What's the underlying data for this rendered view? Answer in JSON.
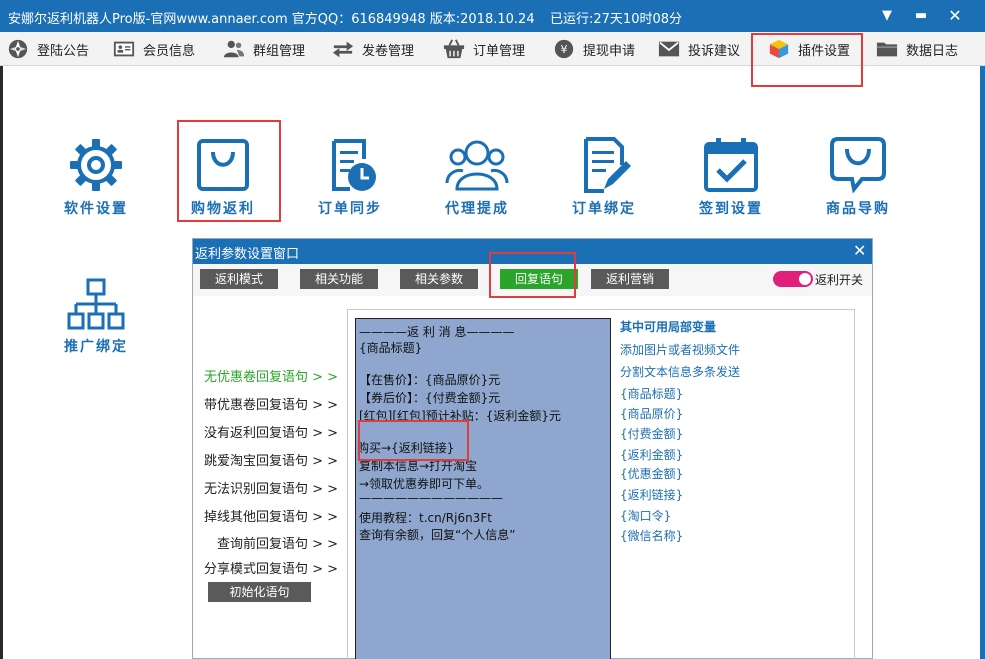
{
  "window": {
    "title": "安娜尔返利机器人Pro版-官网www.annaer.com 官方QQ：616849948 版本:2018.10.24",
    "runtime": "已运行:27天10时08分"
  },
  "menu": [
    {
      "label": "登陆公告",
      "icon": "compass-icon"
    },
    {
      "label": "会员信息",
      "icon": "id-card-icon"
    },
    {
      "label": "群组管理",
      "icon": "group-icon"
    },
    {
      "label": "发卷管理",
      "icon": "swap-arrows-icon"
    },
    {
      "label": "订单管理",
      "icon": "basket-icon"
    },
    {
      "label": "提现申请",
      "icon": "yen-coin-icon"
    },
    {
      "label": "投诉建议",
      "icon": "envelope-icon"
    },
    {
      "label": "插件设置",
      "icon": "cube-icon"
    },
    {
      "label": "数据日志",
      "icon": "folder-icon"
    }
  ],
  "plugins": [
    {
      "label": "软件设置",
      "icon": "gear-icon"
    },
    {
      "label": "购物返利",
      "icon": "shopping-bag-icon"
    },
    {
      "label": "订单同步",
      "icon": "document-clock-icon"
    },
    {
      "label": "代理提成",
      "icon": "people-icon"
    },
    {
      "label": "订单绑定",
      "icon": "document-pen-icon"
    },
    {
      "label": "签到设置",
      "icon": "calendar-check-icon"
    },
    {
      "label": "商品导购",
      "icon": "chat-smile-icon"
    },
    {
      "label": "推广绑定",
      "icon": "hierarchy-icon"
    }
  ],
  "dialog": {
    "title": "返利参数设置窗口",
    "tabs": [
      "返利模式",
      "相关功能",
      "相关参数",
      "回复语句",
      "返利营销"
    ],
    "active_tab": "回复语句",
    "toggle_label": "返利开关",
    "toggle_on": true,
    "toggle_color": "#e0207a",
    "side_items": [
      "无优惠卷回复语句 > >",
      "带优惠卷回复语句 > >",
      "没有返利回复语句 > >",
      "跳爱淘宝回复语句 > >",
      "无法识别回复语句 > >",
      "掉线其他回复语句 > >",
      "查询前回复语句 > >",
      "分享模式回复语句 > >"
    ],
    "init_button": "初始化语句",
    "reply_text": [
      "————返 利 消 息————",
      "{商品标题}",
      "",
      "【在售价】：{商品原价}元",
      "【券后价】：{付费金额}元",
      "[红包][红包]预计补贴：{返利金额}元",
      "",
      "购买→{返利链接}",
      "复制本信息→打开淘宝",
      "→领取优惠券即可下单。",
      "————————————",
      "使用教程：t.cn/Rj6n3Ft",
      "查询有余额，回复“个人信息”"
    ],
    "variables_heading": "其中可用局部变量",
    "variables": [
      "添加图片或者视频文件",
      "分割文本信息多条发送",
      "{商品标题}",
      "{商品原价}",
      "{付费金额}",
      "{返利金额}",
      "{优惠金额}",
      "{返利链接}",
      "{淘口令}",
      "{微信名称}"
    ]
  },
  "colors": {
    "brand_blue": "#1b6fb5",
    "active_green": "#2aa52a",
    "highlight_red": "#e23b3b",
    "text_area_bg": "#8fa7cf"
  }
}
